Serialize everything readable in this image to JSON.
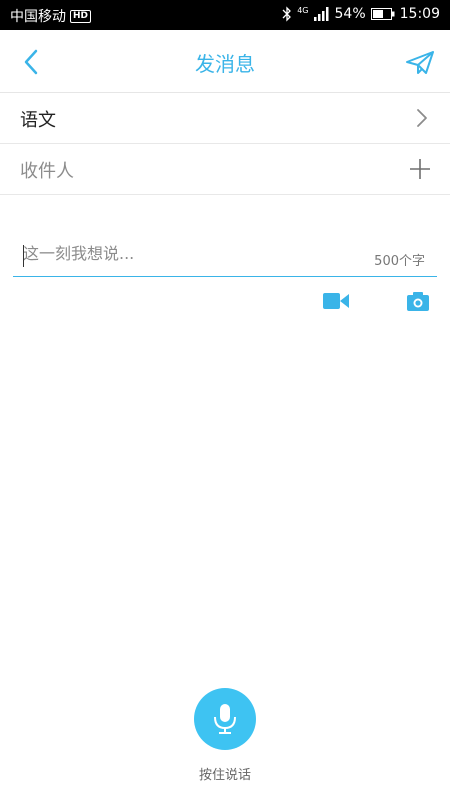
{
  "status_bar": {
    "carrier": "中国移动",
    "hd_badge": "HD",
    "network_type": "4G",
    "battery_percent": "54%",
    "time": "15:09"
  },
  "header": {
    "title": "发消息",
    "back_icon": "chevron-left-icon",
    "send_icon": "paper-plane-icon"
  },
  "subject_row": {
    "label": "语文",
    "icon": "chevron-right-icon"
  },
  "recipient_row": {
    "label": "收件人",
    "icon": "plus-icon"
  },
  "message": {
    "placeholder": "这一刻我想说...",
    "value": "",
    "char_limit": "500个字"
  },
  "media": {
    "video_icon": "video-camera-icon",
    "camera_icon": "camera-icon"
  },
  "voice": {
    "icon": "microphone-icon",
    "label": "按住说话"
  },
  "colors": {
    "accent": "#3ab4e8",
    "mic_background": "#3ec3f2",
    "status_bar_background": "#000000",
    "divider": "#e8e8e8"
  }
}
